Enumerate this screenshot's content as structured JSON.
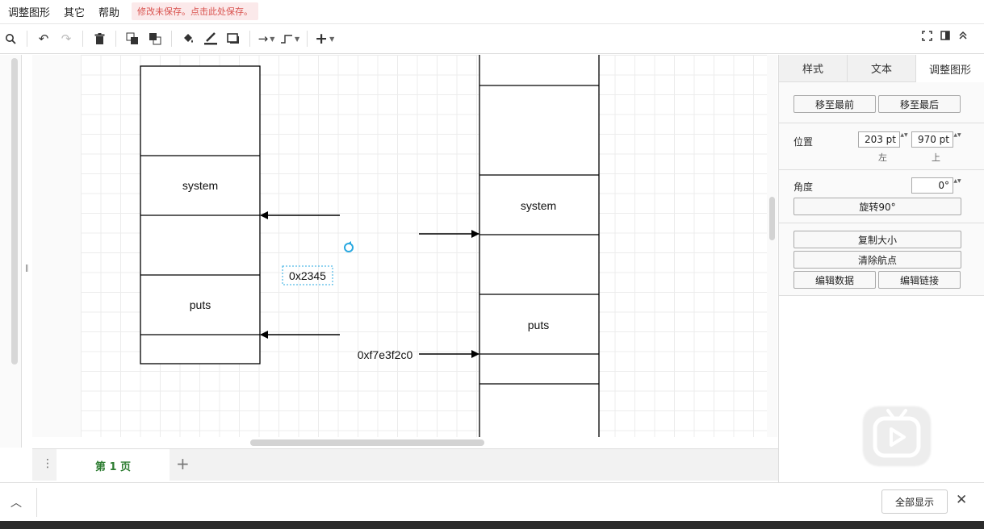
{
  "menu": {
    "items": [
      "调整图形",
      "其它",
      "帮助"
    ],
    "unsaved_notice": "修改未保存。点击此处保存。"
  },
  "toolbar": {
    "icons": [
      "zoom-icon",
      "undo-icon",
      "redo-icon",
      "delete-icon",
      "to-front-icon",
      "to-back-icon",
      "fill-color-icon",
      "line-color-icon",
      "shadow-icon",
      "connection-icon",
      "waypoint-icon",
      "insert-icon"
    ]
  },
  "diagram": {
    "left_stack": {
      "labels": [
        "system",
        "puts"
      ]
    },
    "right_stack": {
      "labels": [
        "system",
        "puts"
      ]
    },
    "selected_label": "0x2345",
    "address_label": "0xf7e3f2c0"
  },
  "pages": {
    "current": "第 1 页"
  },
  "format_panel": {
    "tabs": [
      "样式",
      "文本",
      "调整图形"
    ],
    "active_tab": 2,
    "to_front": "移至最前",
    "to_back": "移至最后",
    "position_label": "位置",
    "left_value": "203 pt",
    "top_value": "970 pt",
    "left_sub": "左",
    "top_sub": "上",
    "angle_label": "角度",
    "angle_value": "0°",
    "rotate_button": "旋转90°",
    "copy_size": "复制大小",
    "clear_waypoints": "清除航点",
    "edit_data": "编辑数据",
    "edit_link": "编辑链接"
  },
  "bottom": {
    "show_all": "全部显示"
  }
}
